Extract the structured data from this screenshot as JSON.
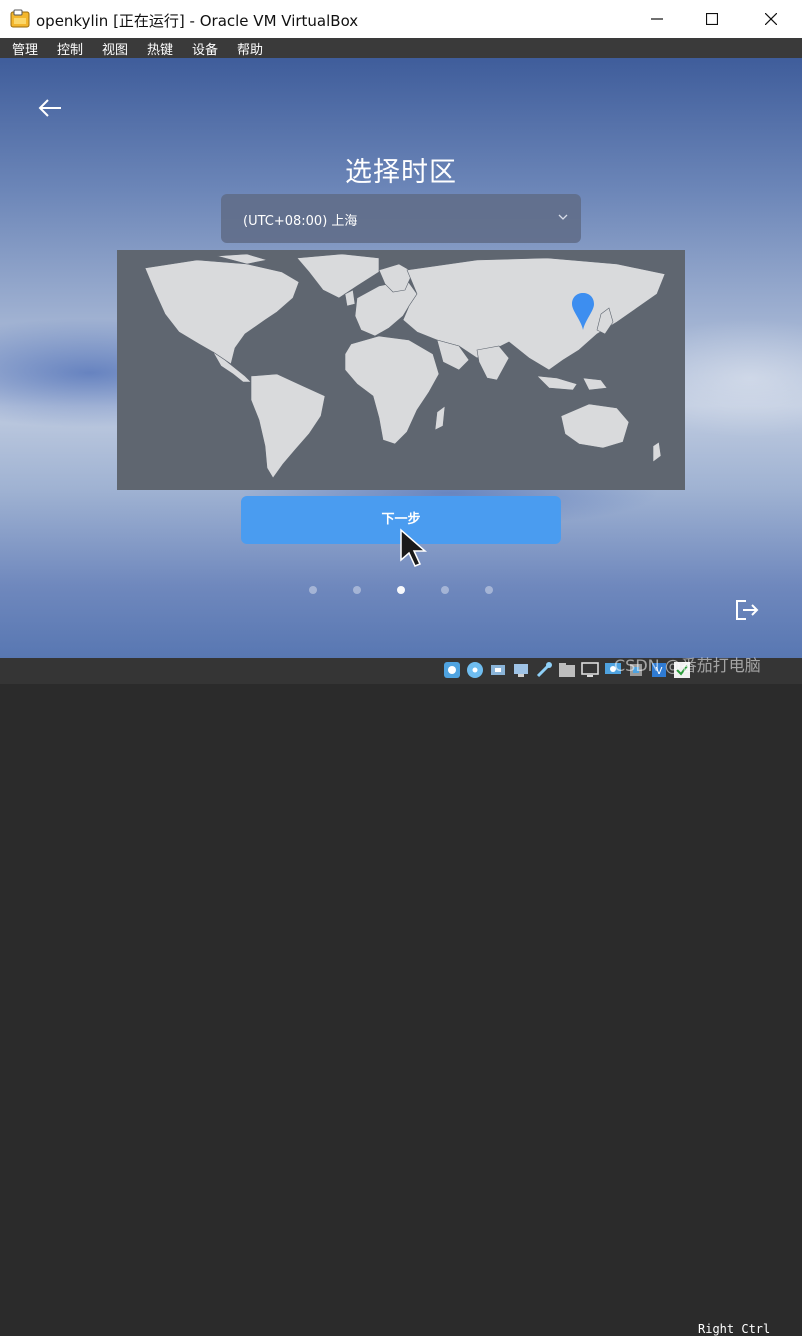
{
  "window": {
    "title": "openkylin [正在运行] - Oracle VM VirtualBox"
  },
  "menubar": {
    "items": [
      "管理",
      "控制",
      "视图",
      "热键",
      "设备",
      "帮助"
    ]
  },
  "installer": {
    "title": "选择时区",
    "timezone": "(UTC+08:00) 上海",
    "next_label": "下一步",
    "steps_total": 5,
    "current_step": 3
  },
  "statusbar": {
    "host_key": "Right Ctrl",
    "watermark": "CSDN @番茄打电脑"
  },
  "colors": {
    "accent": "#4a9cf0",
    "map_water": "#5f6670",
    "map_land": "#d9dadc",
    "pin": "#3d8ef0"
  }
}
